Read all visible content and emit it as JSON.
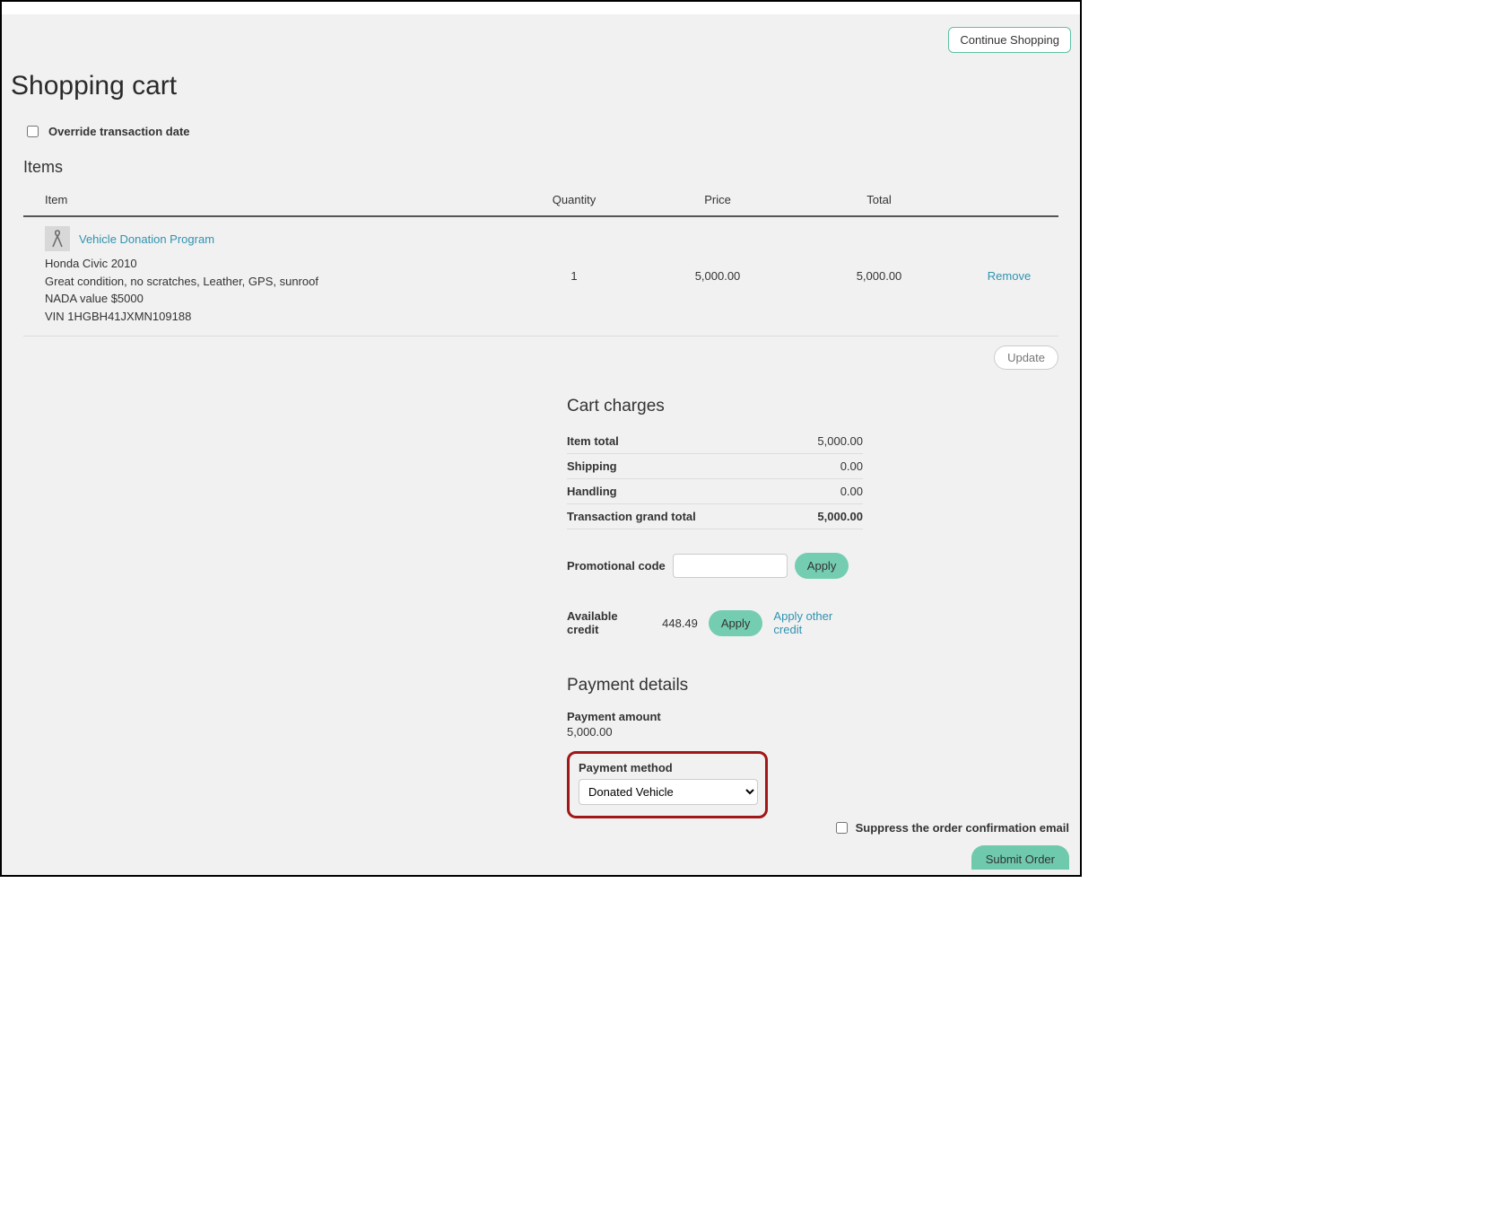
{
  "top": {
    "continue": "Continue Shopping"
  },
  "title": "Shopping cart",
  "override_label": "Override transaction date",
  "items_heading": "Items",
  "columns": {
    "item": "Item",
    "quantity": "Quantity",
    "price": "Price",
    "total": "Total"
  },
  "items": [
    {
      "name": "Vehicle Donation Program",
      "line1": "Honda Civic 2010",
      "line2": "Great condition, no scratches, Leather, GPS, sunroof",
      "line3": "NADA value $5000",
      "line4": "VIN 1HGBH41JXMN109188",
      "quantity": "1",
      "price": "5,000.00",
      "total": "5,000.00",
      "remove": "Remove"
    }
  ],
  "update_label": "Update",
  "charges": {
    "heading": "Cart charges",
    "item_total_label": "Item total",
    "item_total_value": "5,000.00",
    "shipping_label": "Shipping",
    "shipping_value": "0.00",
    "handling_label": "Handling",
    "handling_value": "0.00",
    "grand_label": "Transaction grand total",
    "grand_value": "5,000.00"
  },
  "promo": {
    "label": "Promotional code",
    "apply": "Apply"
  },
  "credit": {
    "label": "Available credit",
    "value": "448.49",
    "apply": "Apply",
    "other": "Apply other credit"
  },
  "payment": {
    "heading": "Payment details",
    "amount_label": "Payment amount",
    "amount_value": "5,000.00",
    "method_label": "Payment method",
    "method_value": "Donated Vehicle"
  },
  "footer": {
    "suppress": "Suppress the order confirmation email",
    "submit": "Submit Order"
  }
}
